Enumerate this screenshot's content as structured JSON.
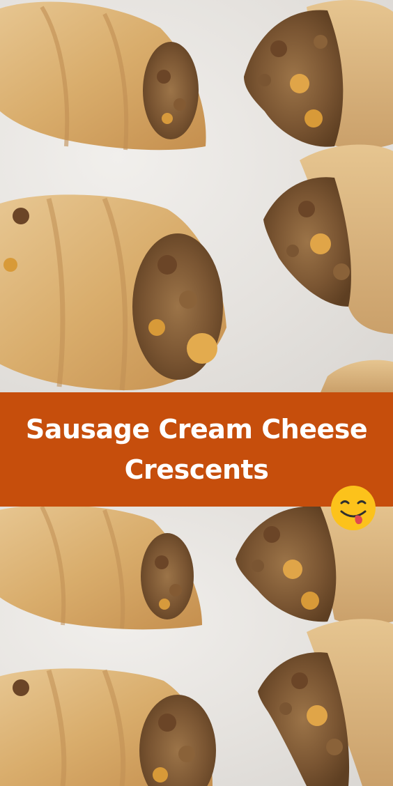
{
  "banner": {
    "title_line_1": "Sausage Cream Cheese",
    "title_line_2": "Crescents",
    "background_color": "#c64e0c",
    "text_color": "#ffffff"
  },
  "decoration": {
    "emoji_icon": "face-savoring-food-icon"
  }
}
